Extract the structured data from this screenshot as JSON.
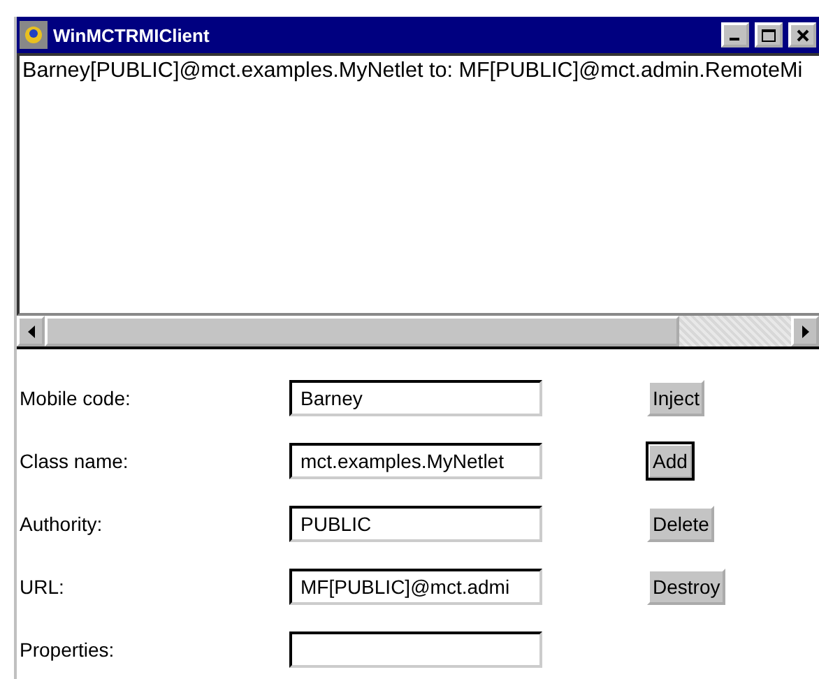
{
  "window": {
    "title": "WinMCTRMIClient"
  },
  "output": {
    "lines": [
      "Barney[PUBLIC]@mct.examples.MyNetlet to: MF[PUBLIC]@mct.admin.RemoteMi"
    ]
  },
  "form": [
    {
      "label": "Mobile code:",
      "value": "Barney",
      "button": "Inject",
      "default": false
    },
    {
      "label": "Class name:",
      "value": "mct.examples.MyNetlet",
      "button": "Add",
      "default": true
    },
    {
      "label": "Authority:",
      "value": "PUBLIC",
      "button": "Delete",
      "default": false
    },
    {
      "label": "URL:",
      "value": "MF[PUBLIC]@mct.admi",
      "button": "Destroy",
      "default": false
    },
    {
      "label": "Properties:"
    }
  ]
}
